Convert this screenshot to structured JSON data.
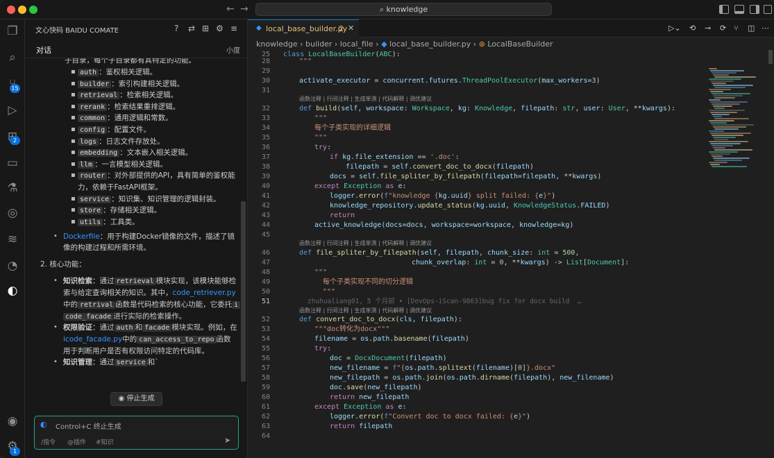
{
  "titlebar": {
    "command_center": "knowledge",
    "back_icon": "arrow-left-icon",
    "forward_icon": "arrow-right-icon"
  },
  "activity_bar": {
    "items": [
      {
        "name": "explorer-icon"
      },
      {
        "name": "search-icon"
      },
      {
        "name": "source-control-icon",
        "badge": "15"
      },
      {
        "name": "run-debug-icon"
      },
      {
        "name": "extensions-icon",
        "badge": "2"
      },
      {
        "name": "remote-explorer-icon"
      },
      {
        "name": "testing-icon"
      },
      {
        "name": "git-lens-icon"
      },
      {
        "name": "docker-icon"
      },
      {
        "name": "timeline-icon"
      },
      {
        "name": "comate-icon"
      }
    ],
    "account_icon": "account-icon",
    "settings_icon": "settings-gear-icon",
    "settings_badge": "1"
  },
  "sidebar": {
    "title": "文心快码 BAIDU COMATE",
    "tab_chat": "对话",
    "tab_right": "小度",
    "stop_button": "停止生成",
    "input_placeholder": "Control+C 终止生成",
    "hint_command": "/指令",
    "hint_plugin": "@插件",
    "hint_knowledge": "#知识",
    "chat": {
      "intro": "子目录，每个子目录都有其特定的功能。",
      "dirs": [
        {
          "code": "auth",
          "desc": "：鉴权相关逻辑。"
        },
        {
          "code": "builder",
          "desc": "：索引构建相关逻辑。"
        },
        {
          "code": "retrieval",
          "desc": "：检索相关逻辑。"
        },
        {
          "code": "rerank",
          "desc": "：检索结果重排逻辑。"
        },
        {
          "code": "common",
          "desc": "：通用逻辑和常数。"
        },
        {
          "code": "config",
          "desc": "：配置文件。"
        },
        {
          "code": "logs",
          "desc": "：日志文件存放处。"
        },
        {
          "code": "embedding",
          "desc": "：文本嵌入相关逻辑。"
        },
        {
          "code": "llm",
          "desc": "：一言模型相关逻辑。"
        },
        {
          "code": "router",
          "desc": "：对外部提供的API，具有简单的鉴权能",
          "desc2": "力，依赖于FastAPI框架。"
        },
        {
          "code": "service",
          "desc": "：知识集、知识管理的逻辑封装。"
        },
        {
          "code": "store",
          "desc": "：存储相关逻辑。"
        },
        {
          "code": "utils",
          "desc": "：工具类。"
        }
      ],
      "dockerfile_link": "Dockerfile",
      "dockerfile_desc": "：用于构建Docker镜像的文件，描述了镜",
      "dockerfile_desc2": "像的构建过程和所需环境。",
      "section2": "2. 核心功能：",
      "k1_title": "知识检索",
      "k1_a": "：通过",
      "k1_code": "retrieval",
      "k1_b": "模块实现，该模块能够检",
      "k1_line2a": "索与给定查询相关的知识。其中，",
      "k1_link": "code_retriever.py",
      "k1_line3a": "中的",
      "k1_code2": "retrival",
      "k1_line3b": "函数是代码检索的核心功能，它委托",
      "k1_code3a": "i",
      "k1_code3b": "code_facade",
      "k1_line4": "进行实际的检索操作。",
      "k2_title": "权限验证",
      "k2_a": "：通过",
      "k2_code": "auth",
      "k2_b": "和",
      "k2_code2": "facade",
      "k2_c": "模块实现。例如，在",
      "k2_link": "icode_facade.py",
      "k2_line2a": "中的",
      "k2_code3": "can_access_to_repo",
      "k2_line2b": "函数",
      "k2_line3": "用于判断用户是否有权限访问特定的代码库。",
      "k3_title": "知识管理",
      "k3_a": "：通过",
      "k3_code": "service",
      "k3_b": "和`"
    }
  },
  "editor": {
    "tab_label": "local_base_builder.py",
    "tab_badge": "2",
    "breadcrumbs": [
      "knowledge",
      "builder",
      "local_file",
      "local_base_builder.py",
      "LocalBaseBuilder"
    ],
    "codelens": "函数注释 | 行间注释 | 生成单测 | 代码解释 | 调优建议",
    "blame": "zhuhualiang01, 5 个月前 • [DevOps-iScan-9863]bug fix for docx build  …",
    "line_numbers": [
      "25",
      "28",
      "29",
      "30",
      "31",
      "32",
      "33",
      "34",
      "35",
      "36",
      "37",
      "38",
      "39",
      "40",
      "41",
      "42",
      "43",
      "44",
      "45",
      "46",
      "47",
      "48",
      "49",
      "50",
      "51",
      "52",
      "53",
      "54",
      "55",
      "56",
      "57",
      "58",
      "59",
      "60",
      "61",
      "62",
      "63",
      "64"
    ]
  }
}
